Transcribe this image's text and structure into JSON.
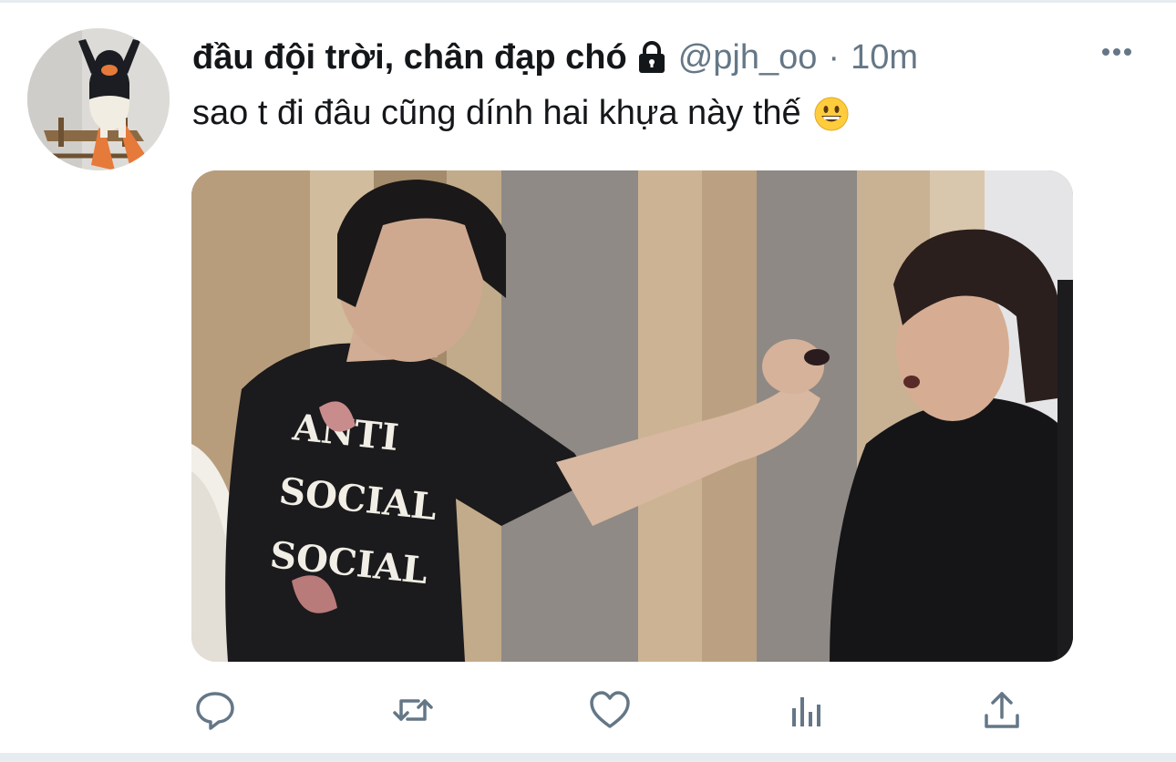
{
  "tweet": {
    "display_name": "đầu đội trời, chân đạp chó",
    "handle": "@pjh_oo",
    "separator": "·",
    "time": "10m",
    "text": "sao t đi đâu cũng dính hai khựa này thế",
    "protected": true,
    "protected_icon": "lock-icon",
    "text_emoji": "grinning-face-emoji",
    "media_text": "ANTI SOCIAL SOCIAL"
  },
  "actions": [
    {
      "id": "reply",
      "icon": "reply-icon"
    },
    {
      "id": "retweet",
      "icon": "retweet-icon"
    },
    {
      "id": "like",
      "icon": "heart-icon"
    },
    {
      "id": "analytics",
      "icon": "analytics-icon"
    },
    {
      "id": "share",
      "icon": "share-icon"
    }
  ],
  "colors": {
    "text_primary": "#14171a",
    "text_secondary": "#657786",
    "icon": "#657786",
    "divider": "#e6ecf0"
  }
}
